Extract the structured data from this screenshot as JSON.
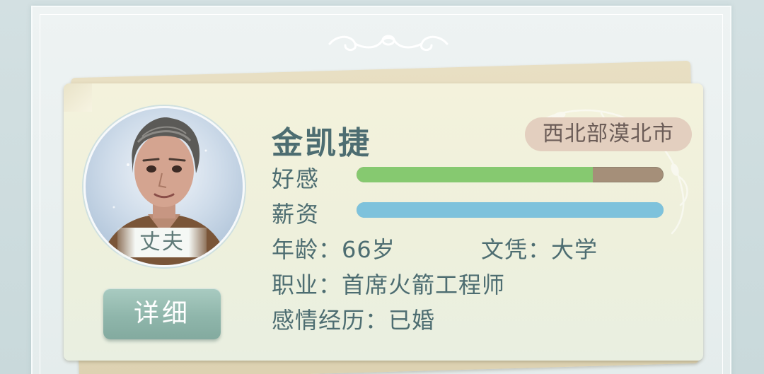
{
  "character": {
    "name": "金凯捷",
    "region": "西北部漠北市",
    "role": "丈夫"
  },
  "stats": {
    "affection_label": "好感",
    "affection_level": 0.77,
    "affection_color": "#86c970",
    "affection_track_color": "#a58f79",
    "salary_label": "薪资",
    "salary_level": 1.0,
    "salary_color": "#7ec2dc",
    "salary_track_color": "#7ec2dc"
  },
  "info": {
    "age_label": "年龄：",
    "age_value": "66岁",
    "education_label": "文凭：",
    "education_value": "大学",
    "job_label": "职业：",
    "job_value": "首席火箭工程师",
    "relationship_label": "感情经历：",
    "relationship_value": "已婚"
  },
  "buttons": {
    "detail_label": "详细"
  },
  "colors": {
    "accent_teal": "#4d6d71",
    "button_green": "#8fb6ab",
    "badge_bg": "#e3cfbf"
  }
}
